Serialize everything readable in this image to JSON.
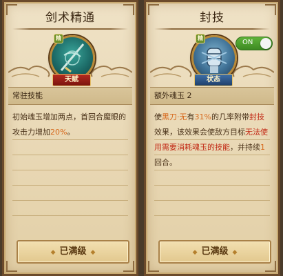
{
  "left_card": {
    "title": "剑术精通",
    "emblem_tag": "精",
    "banner": "天赋",
    "section": "常驻技能",
    "desc_part1": "初始魂玉增加两点，首回合魔眼的攻击力增加",
    "desc_highlight": "20%",
    "desc_part2": "。",
    "button_label": "已满级",
    "icon": "sword-talent-icon"
  },
  "right_card": {
    "title": "封技",
    "toggle_label": "ON",
    "toggle_state": "on",
    "emblem_tag": "精",
    "banner": "状态",
    "section": "额外魂玉 2",
    "desc_a": "使",
    "desc_b": "黑刀·无",
    "desc_c": "有",
    "desc_d": "31%",
    "desc_e": "的几率附带",
    "desc_f": "封技",
    "desc_g": "效果，该效果会使敌方目标",
    "desc_h": "无法使用需要消耗魂玉的技能",
    "desc_i": "，并持续",
    "desc_j": "1",
    "desc_k": "回合。",
    "button_label": "已满级",
    "icon": "sealed-fist-icon"
  },
  "colors": {
    "accent_orange": "#d6671a",
    "accent_red": "#c22a16",
    "toggle_green": "#4c9e2c"
  }
}
